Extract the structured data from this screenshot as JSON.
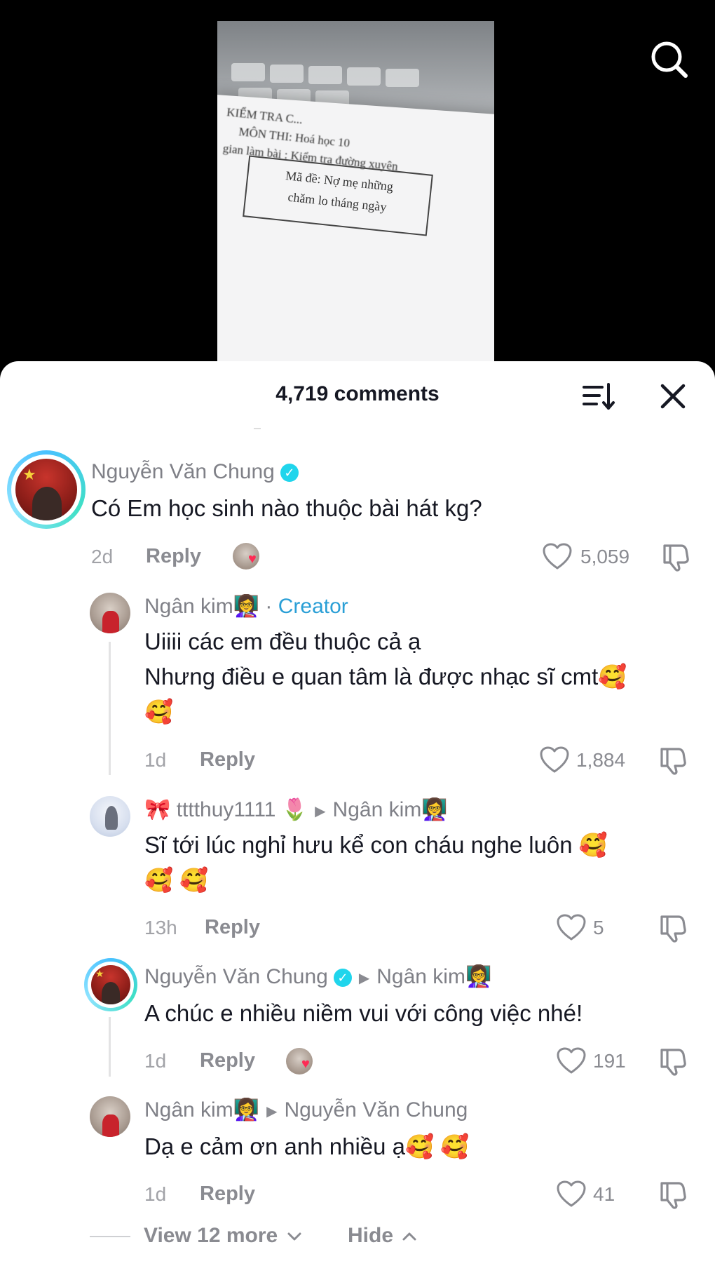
{
  "video": {
    "paper_line1": "KIỂM TRA C...",
    "paper_line2": "MÔN THI: Hoá học 10",
    "paper_line3": "gian làm bài : Kiểm tra đường xuyên",
    "paper_box_line1": "Mã đề: Nợ mẹ những",
    "paper_box_line2": "chăm lo tháng ngày"
  },
  "header": {
    "comments_count": "4,719 comments"
  },
  "comments": [
    {
      "username": "Nguyễn Văn Chung",
      "verified": true,
      "text": "Có Em học sinh nào thuộc bài hát kg?",
      "time": "2d",
      "reply_label": "Reply",
      "likes": "5,059"
    },
    {
      "username": "Ngân kim👩‍🏫",
      "creator_sep": "·",
      "creator_label": "Creator",
      "text_line1": "Uiiii các em đều thuộc cả ạ",
      "text_line2": "Nhưng điều e quan tâm là được nhạc sĩ cmt🥰",
      "text_line3": "🥰",
      "time": "1d",
      "reply_label": "Reply",
      "likes": "1,884"
    },
    {
      "username": "🎀 tttthuy1111 🌷",
      "reply_to": "Ngân kim👩‍🏫",
      "text_line1": "Sĩ tới lúc nghỉ hưu kể con cháu nghe luôn 🥰",
      "text_line2": "🥰 🥰",
      "time": "13h",
      "reply_label": "Reply",
      "likes": "5"
    },
    {
      "username": "Nguyễn Văn Chung",
      "verified": true,
      "reply_to": "Ngân kim👩‍🏫",
      "text": "A chúc e nhiều niềm vui với công việc nhé!",
      "time": "1d",
      "reply_label": "Reply",
      "likes": "191"
    },
    {
      "username": "Ngân kim👩‍🏫",
      "reply_to": "Nguyễn Văn Chung",
      "text": "Dạ e cảm ơn anh nhiều ạ🥰 🥰",
      "time": "1d",
      "reply_label": "Reply",
      "likes": "41"
    }
  ],
  "footer": {
    "view_more": "View 12 more",
    "hide": "Hide"
  },
  "colors": {
    "verified": "#20d5ec",
    "creator": "#2a9fd6",
    "heart": "#fe2c55"
  }
}
